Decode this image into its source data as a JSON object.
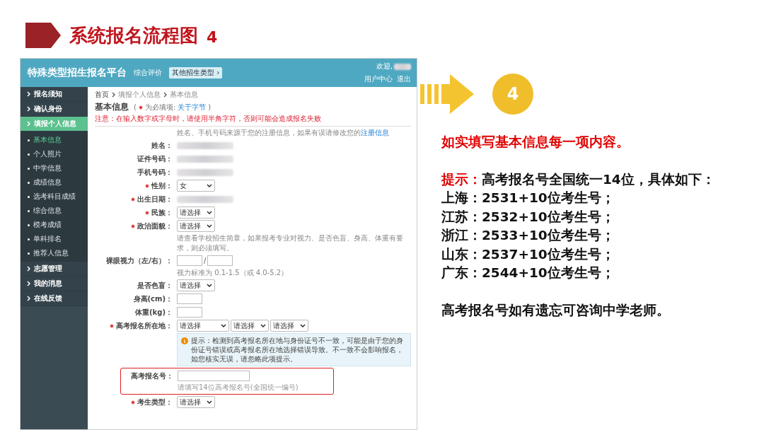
{
  "slide": {
    "title": "系统报名流程图",
    "number": "4"
  },
  "screenshot": {
    "topbar": {
      "title": "特殊类型招生报名平台",
      "subtitle": "综合评价",
      "switch_button": "其他招生类型 ›",
      "welcome": "欢迎,",
      "links": [
        "用户中心",
        "退出"
      ]
    },
    "sidebar": {
      "items": [
        {
          "label": "报名须知",
          "selected": false
        },
        {
          "label": "确认身份",
          "selected": false
        },
        {
          "label": "填报个人信息",
          "selected": true,
          "children": [
            {
              "label": "基本信息",
              "selected": true
            },
            {
              "label": "个人照片",
              "selected": false
            },
            {
              "label": "中学信息",
              "selected": false
            },
            {
              "label": "成绩信息",
              "selected": false
            },
            {
              "label": "选考科目成绩",
              "selected": false
            },
            {
              "label": "综合信息",
              "selected": false
            },
            {
              "label": "模考成绩",
              "selected": false
            },
            {
              "label": "单科排名",
              "selected": false
            },
            {
              "label": "推荐人信息",
              "selected": false
            }
          ]
        },
        {
          "label": "志愿管理",
          "selected": false
        },
        {
          "label": "我的消息",
          "selected": false
        },
        {
          "label": "在线反馈",
          "selected": false
        }
      ]
    },
    "breadcrumb": [
      "首页",
      "填报个人信息",
      "基本信息"
    ],
    "section": {
      "title": "基本信息",
      "legend_before": "(",
      "legend_text": "为必填项:",
      "legend_link": "关于字节",
      "legend_after": ")",
      "warning": "注意：在输入数字或字母时，请使用半角字符，否则可能会造成报名失败"
    },
    "form": [
      {
        "kind": "note",
        "text": "姓名、手机号码来源于您的注册信息，如果有误请修改您的",
        "link": "注册信息"
      },
      {
        "kind": "blurred",
        "label": "姓名：",
        "required": false
      },
      {
        "kind": "blurred",
        "label": "证件号码：",
        "required": false
      },
      {
        "kind": "blurred",
        "label": "手机号码：",
        "required": false
      },
      {
        "kind": "select",
        "label": "性别：",
        "required": true,
        "value": "女"
      },
      {
        "kind": "blurred",
        "label": "出生日期：",
        "required": true
      },
      {
        "kind": "select",
        "label": "民族：",
        "required": true,
        "value": "请选择"
      },
      {
        "kind": "select",
        "label": "政治面貌：",
        "required": true,
        "value": "请选择"
      },
      {
        "kind": "note",
        "text": "请查看学校招生简章，如果报考专业对视力、是否色盲、身高、体重有要求，则必须填写。"
      },
      {
        "kind": "pair",
        "label": "裸眼视力（左/右）：",
        "required": false,
        "separator": "/"
      },
      {
        "kind": "note",
        "text": "视力标准为 0.1-1.5（或 4.0-5.2）"
      },
      {
        "kind": "select",
        "label": "是否色盲：",
        "required": false,
        "value": "请选择"
      },
      {
        "kind": "input",
        "label": "身高(cm)：",
        "required": false
      },
      {
        "kind": "input",
        "label": "体重(kg)：",
        "required": false
      },
      {
        "kind": "selects",
        "label": "高考报名所在地：",
        "required": true,
        "values": [
          "请选择",
          "请选择",
          "请选择"
        ]
      },
      {
        "kind": "notice",
        "text": "提示：检测到高考报名所在地与身份证号不一致，可能是由于您的身份证号错误或高考报名所在地选择错误导致。不一致不会影响报名，如您核实无误，请忽略此项提示。"
      },
      {
        "kind": "input",
        "label": "高考报名号：",
        "required": false,
        "highlighted": true,
        "hint": "请填写14位高考报名号(全国统一编号)"
      },
      {
        "kind": "select",
        "label": "考生类型：",
        "required": true,
        "value": "请选择"
      }
    ]
  },
  "step": {
    "number": "4"
  },
  "notes": {
    "heading": "如实填写基本信息每一项内容。",
    "tip_label": "提示：",
    "tip_text": "高考报名号全国统一14位，具体如下：",
    "lines": [
      "上海：2531+10位考生号；",
      "江苏：2532+10位考生号；",
      "浙江：2533+10位考生号；",
      "山东：2537+10位考生号；",
      "广东：2544+10位考生号；"
    ],
    "footer": "高考报名号如有遗忘可咨询中学老师。"
  }
}
